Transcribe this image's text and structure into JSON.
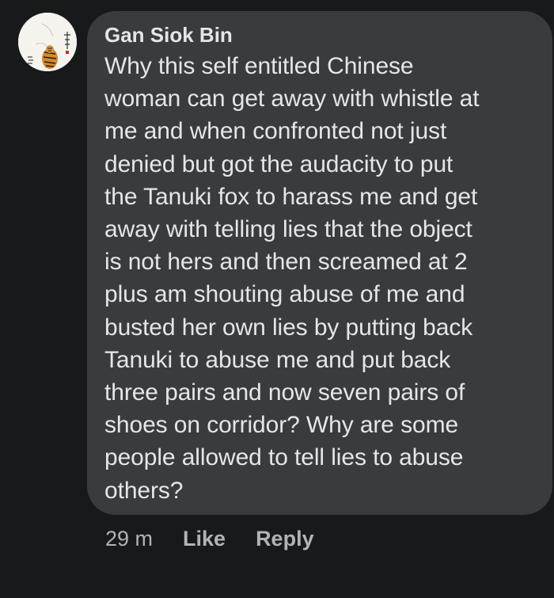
{
  "comment": {
    "author": "Gan Siok Bin",
    "lines": [
      "Why this self entitled Chinese",
      "woman can get away with whistle at",
      "me and when confronted not just",
      "denied but got the audacity to put",
      "the Tanuki fox to harass me and get",
      "away with telling lies that the object",
      "is not hers and then screamed at 2",
      "plus am shouting abuse of me and",
      "busted her own lies by putting back",
      "Tanuki to abuse me and put back",
      "three pairs and now seven pairs of",
      "shoes on corridor? Why are some",
      "people allowed to tell lies to abuse",
      "others?"
    ],
    "timestamp": "29 m",
    "like_label": "Like",
    "reply_label": "Reply"
  },
  "avatar": {
    "icon": "tiger-painting-avatar-icon"
  },
  "colors": {
    "background": "#18191a",
    "bubble": "#3a3b3c",
    "text": "#e4e6eb",
    "secondary_text": "#b0b3b8"
  }
}
